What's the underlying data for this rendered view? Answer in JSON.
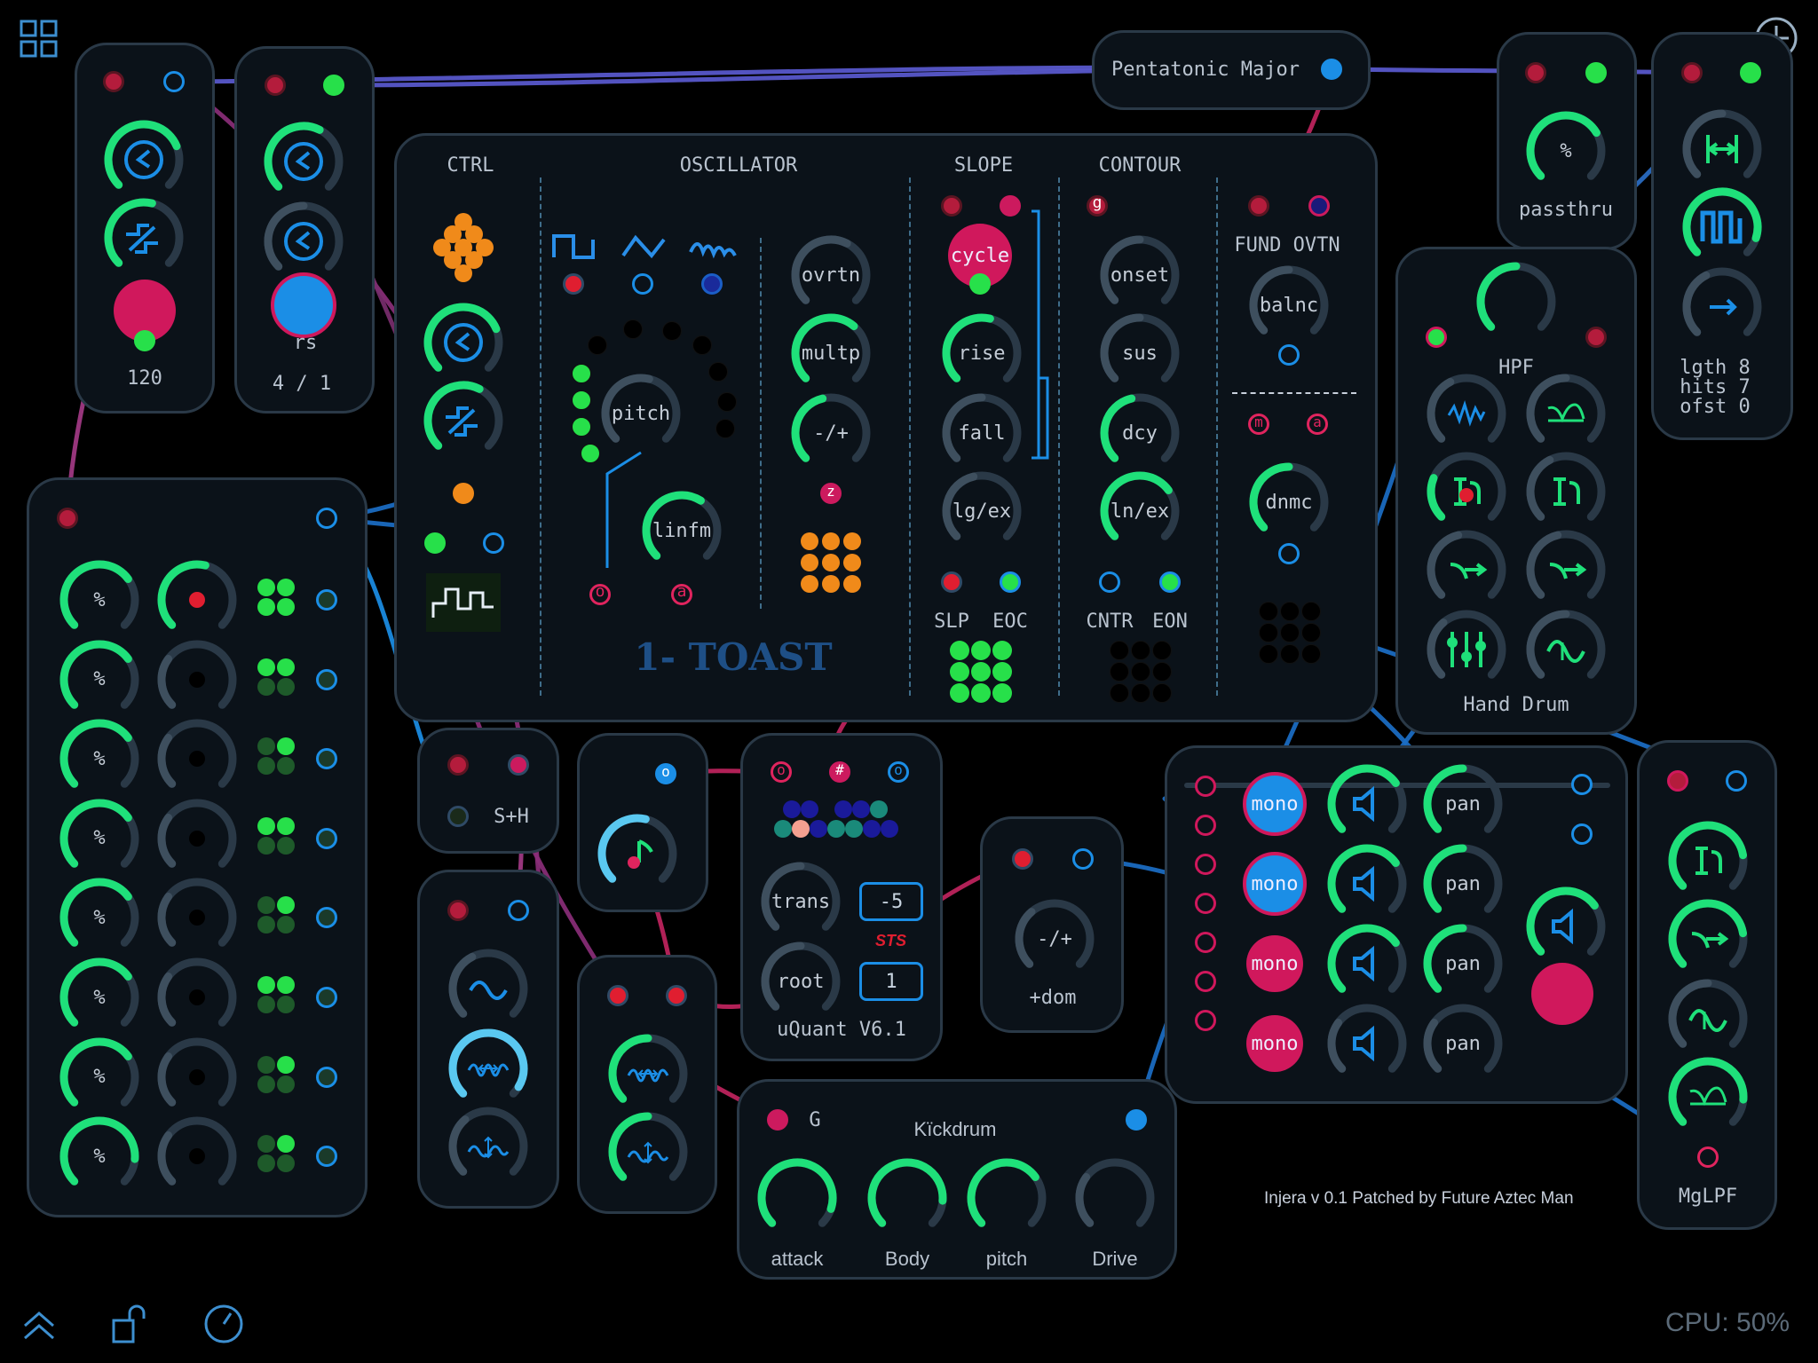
{
  "toolbar": {
    "cpu": "CPU: 50%"
  },
  "credit": "Injera v 0.1 Patched by Future Aztec Man",
  "clock1": {
    "value": "120"
  },
  "clock2": {
    "value": "4 / 1",
    "jack_label": "rs"
  },
  "scale": {
    "name": "Pentatonic Major"
  },
  "passthru": {
    "label": "passthru",
    "knob": "%"
  },
  "euclid": {
    "lgth": "lgth 8",
    "hits": "hits 7",
    "ofst": "ofst 0"
  },
  "toast": {
    "title": "1- TOAST",
    "sections": {
      "ctrl": "CTRL",
      "osc": "OSCILLATOR",
      "slope": "SLOPE",
      "contour": "CONTOUR",
      "fund": "FUND OVTN"
    },
    "knobs": {
      "ovrtn": "ovrtn",
      "multp": "multp",
      "plusminus": "-/+",
      "pitch": "pitch",
      "linfm": "linfm",
      "cycle": "cycle",
      "rise": "rise",
      "fall": "fall",
      "lgex": "lg/ex",
      "onset": "onset",
      "sus": "sus",
      "dcy": "dcy",
      "lnex": "ln/ex",
      "balnc": "balnc",
      "dnmc": "dnmc"
    },
    "jacks": {
      "z": "z",
      "o": "o",
      "a": "a",
      "g": "g",
      "m": "m",
      "a2": "a"
    },
    "outs": {
      "slp": "SLP",
      "eoc": "EOC",
      "cntr": "CNTR",
      "eon": "EON"
    }
  },
  "hpf": {
    "title": "HPF",
    "sub": "Hand Drum"
  },
  "mixer_left": {
    "knob": "%"
  },
  "sh": {
    "label": "S+H"
  },
  "quant": {
    "trans": "trans",
    "root": "root",
    "trans_val": "-5",
    "root_val": "1",
    "name": "uQuant V6.1",
    "logo": "STS",
    "j1": "o",
    "j2": "#",
    "j3": "o",
    "j0": "o"
  },
  "dom": {
    "knob": "-/+",
    "label": "+dom"
  },
  "kick": {
    "gate": "G",
    "title": "Kïckdrum",
    "attack": "attack",
    "body": "Body",
    "pitch": "pitch",
    "drive": "Drive"
  },
  "mixer4": {
    "mono": "mono",
    "pan": "pan"
  },
  "mglpf": {
    "label": "MgLPF"
  }
}
